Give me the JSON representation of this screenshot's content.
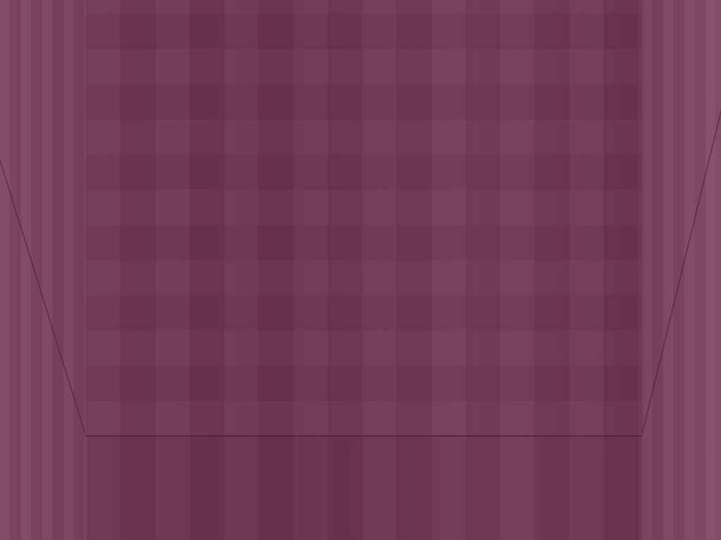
{
  "scene": {
    "view": "first-person-corridor",
    "colors": {
      "back_wall": "#6e3651",
      "side_walls": "#7d4664",
      "floor": "#6c3550",
      "edge_line": "#4a1f33"
    }
  }
}
